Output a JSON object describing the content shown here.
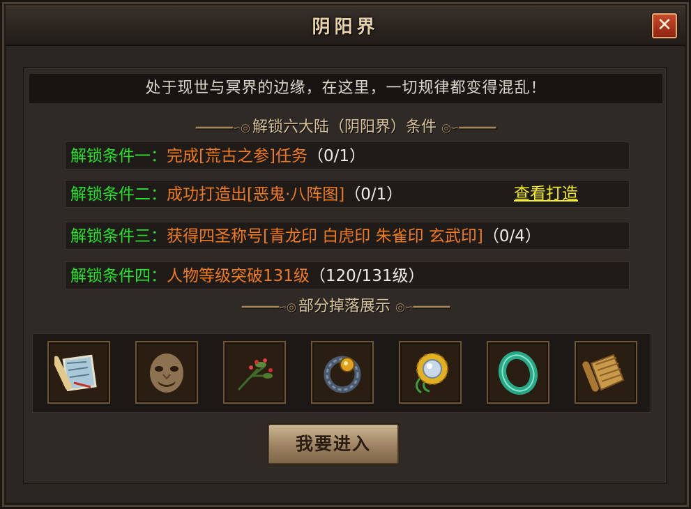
{
  "window": {
    "title": "阴阳界",
    "close_label": "✕"
  },
  "description": "处于现世与冥界的边缘，在这里，一切规律都变得混乱！",
  "unlock_section": {
    "title": "解锁六大陆（阴阳界）条件"
  },
  "conditions": [
    {
      "label": "解锁条件一：",
      "text": "完成[荒古之参]任务",
      "progress": "（0/1）"
    },
    {
      "label": "解锁条件二：",
      "text": "成功打造出[恶鬼·八阵图]",
      "progress": "（0/1）",
      "link": "查看打造"
    },
    {
      "label": "解锁条件三：",
      "text": "获得四圣称号[青龙印 白虎印 朱雀印 玄武印]",
      "progress": "（0/4）"
    },
    {
      "label": "解锁条件四：",
      "text": "人物等级突破131级",
      "progress": "（120/131级）"
    }
  ],
  "drops_section": {
    "title": "部分掉落展示"
  },
  "drops": [
    {
      "icon": "scroll-map-icon"
    },
    {
      "icon": "demon-mask-icon"
    },
    {
      "icon": "herb-branch-icon"
    },
    {
      "icon": "gem-bracelet-icon"
    },
    {
      "icon": "sunflower-amulet-icon"
    },
    {
      "icon": "jade-ring-icon"
    },
    {
      "icon": "bamboo-scroll-icon"
    }
  ],
  "enter_button": {
    "label": "我要进入"
  }
}
